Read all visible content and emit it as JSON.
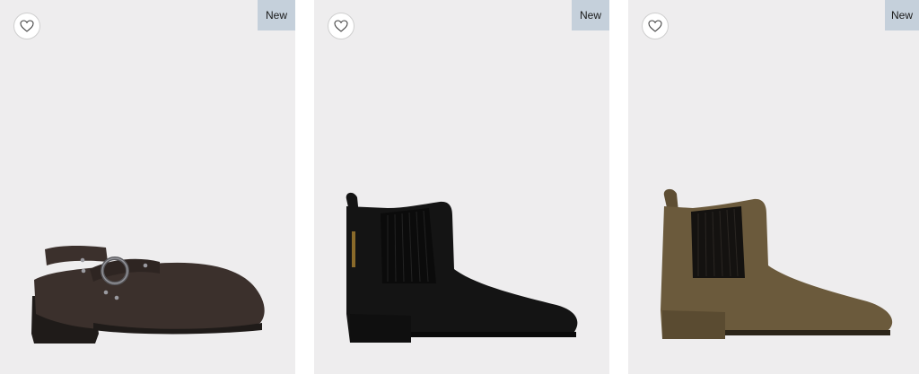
{
  "products": [
    {
      "badge": "New",
      "favorite_icon": "heart-outline-icon",
      "image": "dark-brown-leather-mule-with-silver-ring-strap",
      "shoe_color": "#3b302c"
    },
    {
      "badge": "New",
      "favorite_icon": "heart-outline-icon",
      "image": "black-suede-chelsea-boot",
      "shoe_color": "#141414"
    },
    {
      "badge": "New",
      "favorite_icon": "heart-outline-icon",
      "image": "olive-brown-suede-chelsea-boot",
      "shoe_color": "#6b5a3c"
    }
  ],
  "colors": {
    "card_background": "#eeedee",
    "badge_background": "#c5d0db"
  }
}
